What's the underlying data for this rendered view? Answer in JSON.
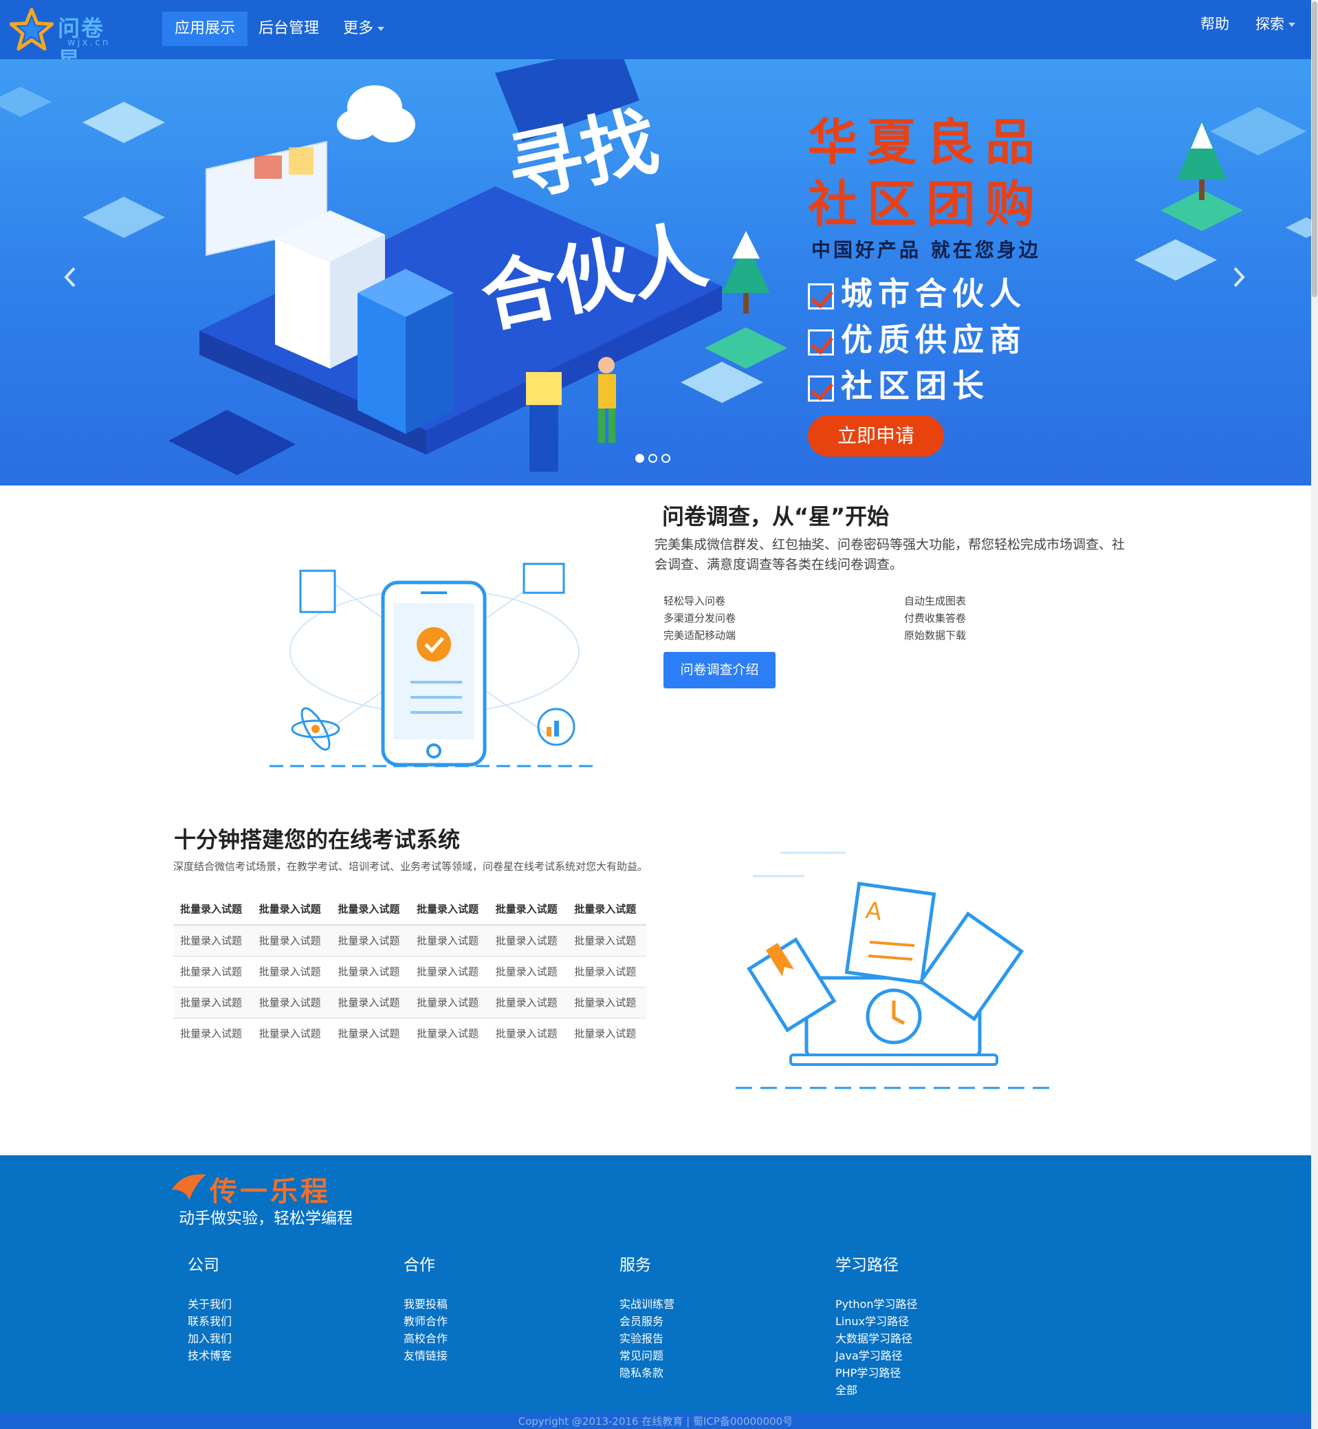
{
  "navbar": {
    "logo_text": "问卷星",
    "logo_sub": "wjx.cn",
    "items": [
      "应用展示",
      "后台管理",
      "更多"
    ],
    "right_items": [
      "帮助",
      "探索"
    ]
  },
  "banner": {
    "art_text": [
      "寻找",
      "合伙人"
    ],
    "title_line1": "华夏良品",
    "title_line2": "社区团购",
    "subtitle": "中国好产品  就在您身边",
    "checks": [
      "城市合伙人",
      "优质供应商",
      "社区团长"
    ],
    "apply_button": "立即申请",
    "prev_icon": "chevron-left-icon",
    "next_icon": "chevron-right-icon",
    "slides_count": 3,
    "active_slide": 1
  },
  "survey": {
    "title": "问卷调查，从“星”开始",
    "description": "完美集成微信群发、红包抽奖、问卷密码等强大功能，帮您轻松完成市场调查、社会调查、满意度调查等各类在线问卷调查。",
    "features_left": [
      "轻松导入问卷",
      "多渠道分发问卷",
      "完美适配移动端"
    ],
    "features_right": [
      "自动生成图表",
      "付费收集答卷",
      "原始数据下载"
    ],
    "button": "问卷调查介绍"
  },
  "exam": {
    "title": "十分钟搭建您的在线考试系统",
    "description": "深度结合微信考试场景，在教学考试、培训考试、业务考试等领域，问卷星在线考试系统对您大有助益。",
    "headers": [
      "批量录入试题",
      "批量录入试题",
      "批量录入试题",
      "批量录入试题",
      "批量录入试题",
      "批量录入试题"
    ],
    "rows": [
      [
        "批量录入试题",
        "批量录入试题",
        "批量录入试题",
        "批量录入试题",
        "批量录入试题",
        "批量录入试题"
      ],
      [
        "批量录入试题",
        "批量录入试题",
        "批量录入试题",
        "批量录入试题",
        "批量录入试题",
        "批量录入试题"
      ],
      [
        "批量录入试题",
        "批量录入试题",
        "批量录入试题",
        "批量录入试题",
        "批量录入试题",
        "批量录入试题"
      ],
      [
        "批量录入试题",
        "批量录入试题",
        "批量录入试题",
        "批量录入试题",
        "批量录入试题",
        "批量录入试题"
      ]
    ]
  },
  "footer": {
    "brand": "传一乐程",
    "slogan": "动手做实验，轻松学编程",
    "columns": [
      {
        "title": "公司",
        "links": [
          "关于我们",
          "联系我们",
          "加入我们",
          "技术博客"
        ]
      },
      {
        "title": "合作",
        "links": [
          "我要投稿",
          "教师合作",
          "高校合作",
          "友情链接"
        ]
      },
      {
        "title": "服务",
        "links": [
          "实战训练营",
          "会员服务",
          "实验报告",
          "常见问题",
          "隐私条款"
        ]
      },
      {
        "title": "学习路径",
        "links": [
          "Python学习路径",
          "Linux学习路径",
          "大数据学习路径",
          "Java学习路径",
          "PHP学习路径",
          "全部"
        ]
      }
    ],
    "copyright": "Copyright @2013-2016 在线教育 | 蜀ICP备00000000号"
  },
  "colors": {
    "nav_bg": "#1b64d6",
    "nav_active": "#2a7ef0",
    "banner_bg": "#3f9cf3",
    "promo_red": "#e64218",
    "primary_button": "#2b7ef5",
    "footer_bg": "#0771c4"
  }
}
